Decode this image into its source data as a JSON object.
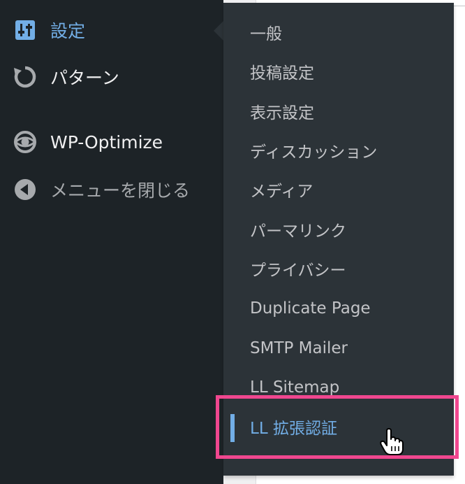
{
  "admin_menu": {
    "items": [
      {
        "label": "設定",
        "icon": "settings-sliders-icon",
        "state": "current"
      },
      {
        "label": "パターン",
        "icon": "refresh-icon",
        "state": "normal"
      },
      {
        "label": "WP-Optimize",
        "icon": "wp-optimize-icon",
        "state": "normal"
      },
      {
        "label": "メニューを閉じる",
        "icon": "collapse-menu-icon",
        "state": "muted"
      }
    ]
  },
  "submenu": {
    "items": [
      {
        "label": "一般"
      },
      {
        "label": "投稿設定"
      },
      {
        "label": "表示設定"
      },
      {
        "label": "ディスカッション"
      },
      {
        "label": "メディア"
      },
      {
        "label": "パーマリンク"
      },
      {
        "label": "プライバシー"
      },
      {
        "label": "Duplicate Page"
      },
      {
        "label": "SMTP Mailer"
      },
      {
        "label": "LL Sitemap"
      },
      {
        "label": "LL 拡張認証",
        "active": true
      }
    ]
  },
  "colors": {
    "menu_bg": "#1d2327",
    "submenu_bg": "#2c3338",
    "accent": "#72aee6",
    "highlight": "#f0478f",
    "text": "#f0f0f1",
    "muted_text": "#a7aaad"
  },
  "cursor": "hand-pointer-icon"
}
